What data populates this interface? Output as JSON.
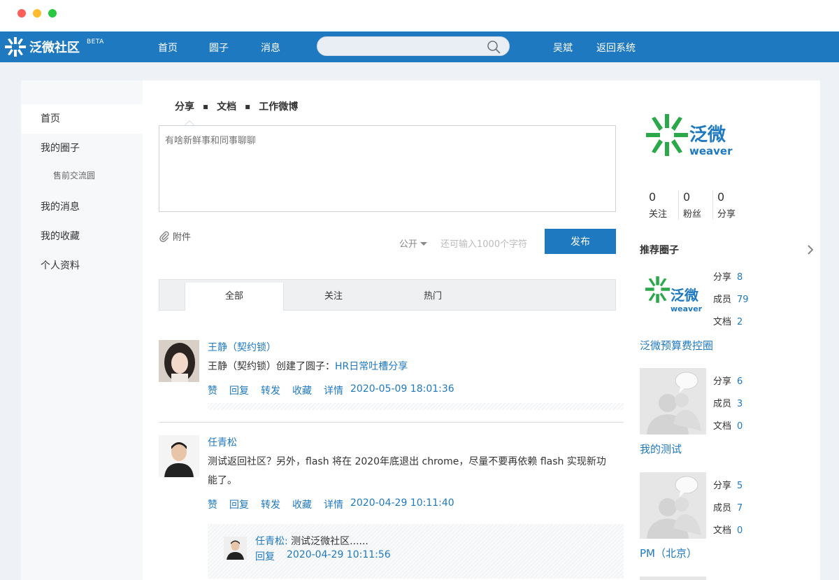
{
  "nav": {
    "brand": "泛微社区",
    "beta": "BETA",
    "links": [
      "首页",
      "圆子",
      "消息"
    ],
    "search_placeholder": "",
    "user": "吴斌",
    "back": "返回系统"
  },
  "sidebar": {
    "items": [
      {
        "label": "首页"
      },
      {
        "label": "我的圈子"
      },
      {
        "label": "我的消息"
      },
      {
        "label": "我的收藏"
      },
      {
        "label": "个人资料"
      }
    ],
    "sub_item": "售前交流圆"
  },
  "compose": {
    "tabs": [
      "分享",
      "文档",
      "工作微博"
    ],
    "separator": "▪",
    "placeholder": "有啥新鲜事和同事聊聊",
    "attach_label": "附件",
    "privacy": "公开",
    "char_hint": "还可输入1000个字符",
    "publish": "发布"
  },
  "feed_tabs": [
    "全部",
    "关注",
    "热门"
  ],
  "posts": [
    {
      "author": "王静（契约锁）",
      "text": "王静（契约锁）创建了圆子：",
      "link": "HR日常吐槽分享",
      "actions": [
        "赞",
        "回复",
        "转发",
        "收藏",
        "详情"
      ],
      "time": "2020-05-09 18:01:36"
    },
    {
      "author": "任青松",
      "text": "测试返回社区？另外，flash 将在 2020年底退出 chrome，尽量不要再依赖 flash 实现新功能了。",
      "actions": [
        "赞",
        "回复",
        "转发",
        "收藏",
        "详情"
      ],
      "time": "2020-04-29 10:11:40",
      "quote": {
        "name": "任青松:",
        "text": "测试泛微社区......",
        "reply": "回复",
        "time": "2020-04-29 10:11:56"
      }
    }
  ],
  "profile": {
    "brand_cn": "泛微",
    "brand_en": "weaver",
    "stats": [
      {
        "num": "0",
        "label": "关注"
      },
      {
        "num": "0",
        "label": "粉丝"
      },
      {
        "num": "0",
        "label": "分享"
      }
    ]
  },
  "recommended": {
    "title": "推荐圈子",
    "circles": [
      {
        "name": "泛微预算费控圈",
        "share_label": "分享",
        "share": "8",
        "member_label": "成员",
        "members": "79",
        "doc_label": "文档",
        "docs": "2"
      },
      {
        "name": "我的测试",
        "share_label": "分享",
        "share": "6",
        "member_label": "成员",
        "members": "3",
        "doc_label": "文档",
        "docs": "0"
      },
      {
        "name": "PM（北京）",
        "share_label": "分享",
        "share": "5",
        "member_label": "成员",
        "members": "7",
        "doc_label": "文档",
        "docs": "0"
      }
    ]
  },
  "colors": {
    "brand_blue": "#1f79c1",
    "logo_green": "#2aa84a"
  }
}
